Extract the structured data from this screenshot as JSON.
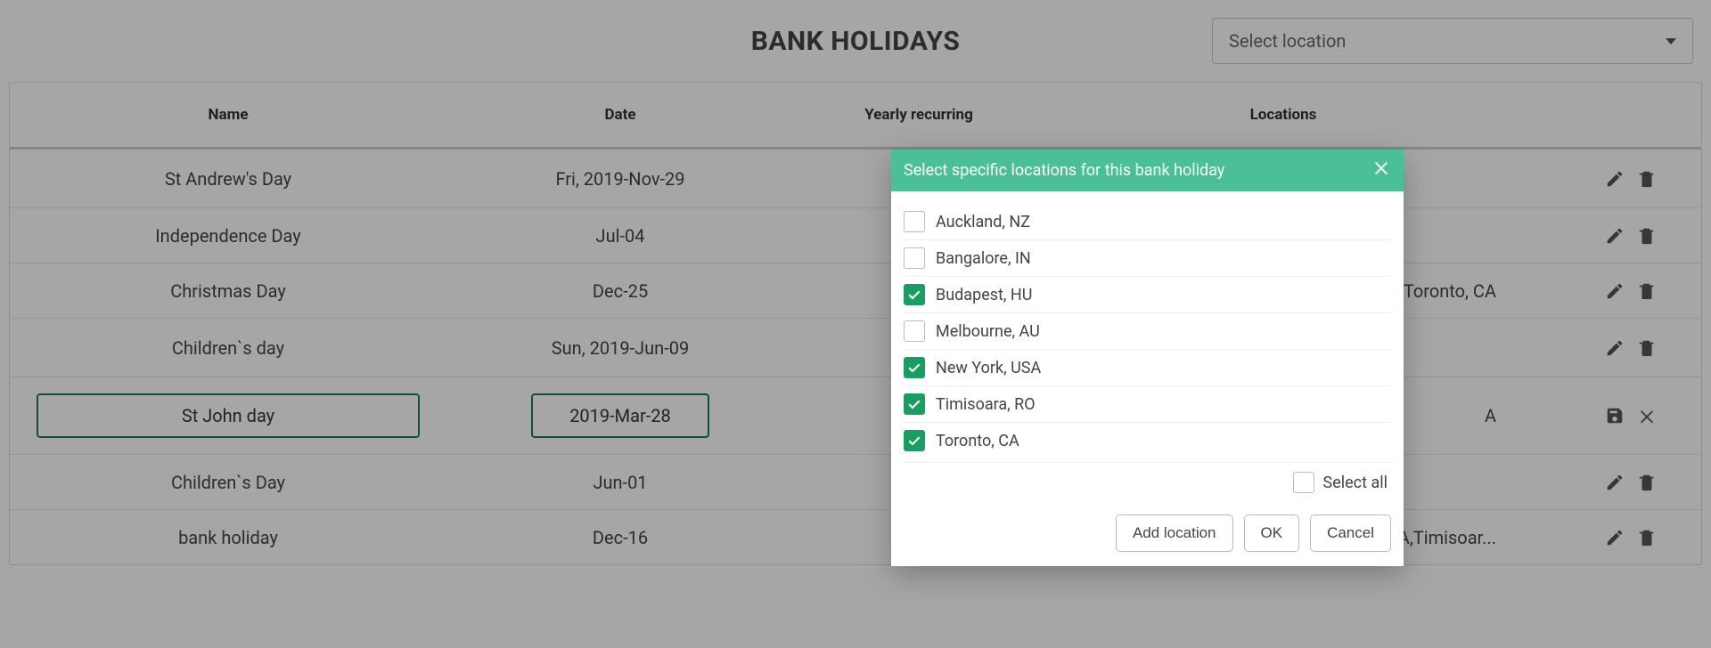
{
  "page": {
    "title": "BANK HOLIDAYS",
    "location_placeholder": "Select location"
  },
  "table": {
    "headers": {
      "name": "Name",
      "date": "Date",
      "recurring": "Yearly recurring",
      "locations": "Locations"
    },
    "rows": [
      {
        "name": "St Andrew's Day",
        "date": "Fri, 2019-Nov-29",
        "recurring": false,
        "recurring_shows_check": false,
        "locations": "",
        "editing": false
      },
      {
        "name": "Independence Day",
        "date": "Jul-04",
        "recurring": true,
        "recurring_shows_check": true,
        "locations": "",
        "editing": false
      },
      {
        "name": "Christmas Day",
        "date": "Dec-25",
        "recurring": true,
        "recurring_shows_check": true,
        "locations": "USA,Toronto, CA",
        "editing": false
      },
      {
        "name": "Children`s day",
        "date": "Sun, 2019-Jun-09",
        "recurring": false,
        "recurring_shows_check": false,
        "locations": "",
        "editing": false
      },
      {
        "name": "St John day",
        "date": "2019-Mar-28",
        "recurring": true,
        "recurring_shows_check": true,
        "locations": "A",
        "editing": true
      },
      {
        "name": "Children`s Day",
        "date": "Jun-01",
        "recurring": true,
        "recurring_shows_check": true,
        "locations": "",
        "editing": false
      },
      {
        "name": "bank holiday",
        "date": "Dec-16",
        "recurring": true,
        "recurring_shows_check": true,
        "locations": "w York, USA,Timisoar...",
        "editing": false
      }
    ]
  },
  "modal": {
    "title": "Select specific locations for this bank holiday",
    "locations": [
      {
        "label": "Auckland, NZ",
        "checked": false
      },
      {
        "label": "Bangalore, IN",
        "checked": false
      },
      {
        "label": "Budapest, HU",
        "checked": true
      },
      {
        "label": "Melbourne, AU",
        "checked": false
      },
      {
        "label": "New York, USA",
        "checked": true
      },
      {
        "label": "Timisoara, RO",
        "checked": true
      },
      {
        "label": "Toronto, CA",
        "checked": true
      }
    ],
    "select_all_label": "Select all",
    "buttons": {
      "add": "Add location",
      "ok": "OK",
      "cancel": "Cancel"
    }
  }
}
